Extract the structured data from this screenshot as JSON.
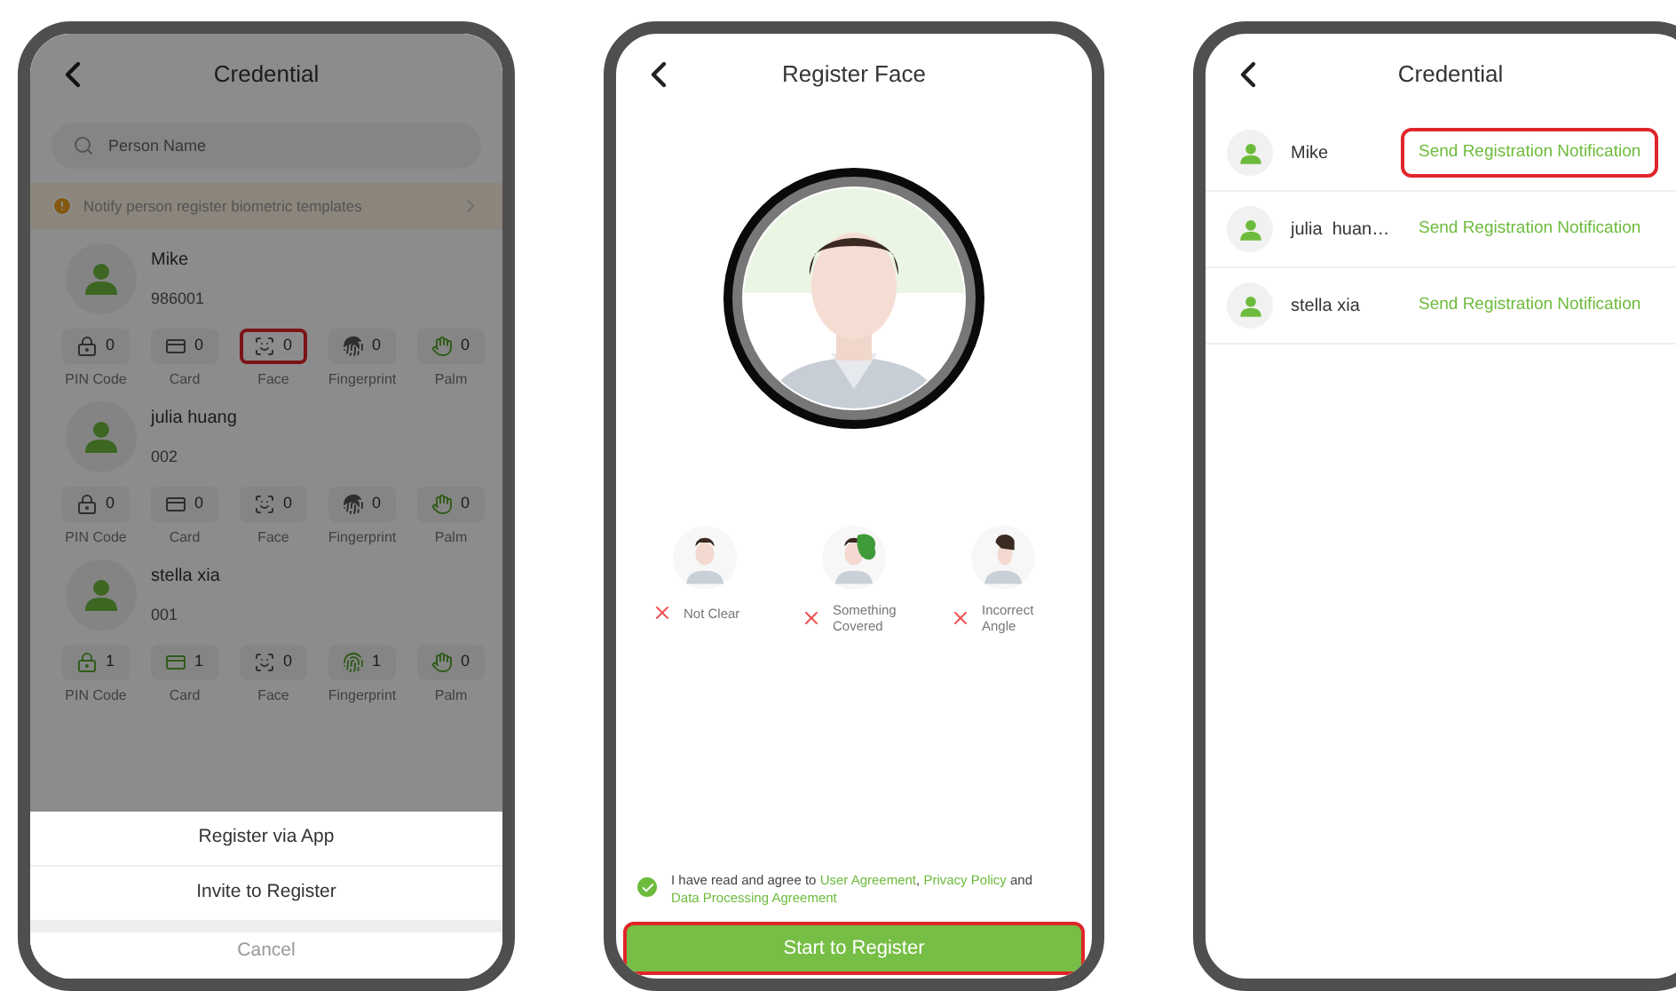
{
  "credential_screen": {
    "title": "Credential",
    "search": {
      "placeholder": "Person Name"
    },
    "notice": "Notify person register biometric templates",
    "persons": [
      {
        "name": "Mike",
        "id": "986001",
        "credentials": [
          {
            "kind": "pin",
            "count": "0",
            "label": "PIN Code",
            "enrolled": false,
            "highlighted": false
          },
          {
            "kind": "card",
            "count": "0",
            "label": "Card",
            "enrolled": false,
            "highlighted": false
          },
          {
            "kind": "face",
            "count": "0",
            "label": "Face",
            "enrolled": false,
            "highlighted": true
          },
          {
            "kind": "fingerprint",
            "count": "0",
            "label": "Fingerprint",
            "enrolled": false,
            "highlighted": false
          },
          {
            "kind": "palm",
            "count": "0",
            "label": "Palm",
            "highlighted": false
          }
        ]
      },
      {
        "name": "julia  huang",
        "id": "002",
        "credentials": [
          {
            "kind": "pin",
            "count": "0",
            "label": "PIN Code",
            "enrolled": false,
            "highlighted": false
          },
          {
            "kind": "card",
            "count": "0",
            "label": "Card",
            "enrolled": false,
            "highlighted": false
          },
          {
            "kind": "face",
            "count": "0",
            "label": "Face",
            "enrolled": false,
            "highlighted": false
          },
          {
            "kind": "fingerprint",
            "count": "0",
            "label": "Fingerprint",
            "enrolled": false,
            "highlighted": false
          },
          {
            "kind": "palm",
            "count": "0",
            "label": "Palm",
            "highlighted": false
          }
        ]
      },
      {
        "name": "stella xia",
        "id": "001",
        "credentials": [
          {
            "kind": "pin",
            "count": "1",
            "label": "PIN Code",
            "enrolled": true,
            "highlighted": false
          },
          {
            "kind": "card",
            "count": "1",
            "label": "Card",
            "enrolled": true,
            "highlighted": false
          },
          {
            "kind": "face",
            "count": "0",
            "label": "Face",
            "enrolled": false,
            "highlighted": false
          },
          {
            "kind": "fingerprint",
            "count": "1",
            "label": "Fingerprint",
            "enrolled": true,
            "highlighted": false
          },
          {
            "kind": "palm",
            "count": "0",
            "label": "Palm",
            "highlighted": false
          }
        ]
      }
    ],
    "sheet": {
      "options": [
        "Register via App",
        "Invite to Register"
      ],
      "cancel": "Cancel"
    }
  },
  "register_face_screen": {
    "title": "Register Face",
    "examples": [
      {
        "kind": "unclear",
        "label": "Not Clear"
      },
      {
        "kind": "covered",
        "label": "Something Covered"
      },
      {
        "kind": "angle",
        "label": "Incorrect Angle"
      }
    ],
    "agreement": {
      "checked": true,
      "text": "I have read and agree to",
      "links": [
        "User Agreement",
        "Privacy Policy",
        "Data Processing Agreement"
      ],
      "separators": [
        ",",
        "and"
      ]
    },
    "button": {
      "label": "Start to Register",
      "highlighted": true
    }
  },
  "notification_screen": {
    "title": "Credential",
    "rows": [
      {
        "name": "Mike",
        "action": "Send Registration Notification",
        "highlighted": true
      },
      {
        "name": "julia  huan…",
        "action": "Send Registration Notification",
        "highlighted": false
      },
      {
        "name": "stella xia",
        "action": "Send Registration Notification",
        "highlighted": false
      }
    ]
  }
}
